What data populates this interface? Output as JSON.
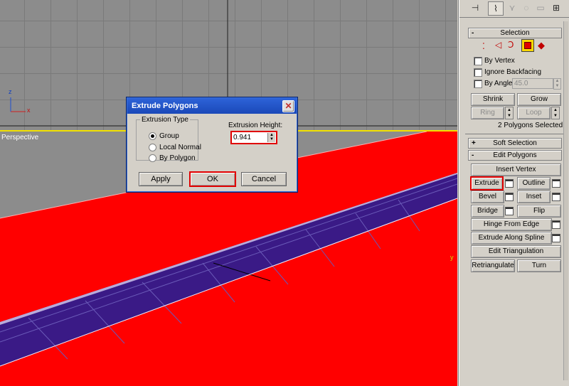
{
  "viewports": {
    "perspective_label": "Perspective",
    "axis_labels": {
      "x": "x",
      "z": "z",
      "y": "y"
    }
  },
  "dialog": {
    "title": "Extrude Polygons",
    "close_glyph": "✕",
    "extrusion_type": {
      "legend": "Extrusion Type",
      "options": [
        "Group",
        "Local Normal",
        "By Polygon"
      ],
      "selected": "Group"
    },
    "extrusion_height": {
      "label": "Extrusion Height:",
      "value": "0.941"
    },
    "buttons": {
      "apply": "Apply",
      "ok": "OK",
      "cancel": "Cancel"
    }
  },
  "panel": {
    "selection": {
      "title": "Selection",
      "by_vertex": "By Vertex",
      "ignore_backfacing": "Ignore Backfacing",
      "by_angle": "By Angle:",
      "angle_value": "45.0",
      "shrink": "Shrink",
      "grow": "Grow",
      "ring": "Ring",
      "loop": "Loop",
      "status": "2 Polygons Selected"
    },
    "soft_selection": {
      "title": "Soft Selection",
      "sign": "+"
    },
    "edit_polygons": {
      "title": "Edit Polygons",
      "sign": "-",
      "insert_vertex": "Insert Vertex",
      "extrude": "Extrude",
      "outline": "Outline",
      "bevel": "Bevel",
      "inset": "Inset",
      "bridge": "Bridge",
      "flip": "Flip",
      "hinge_from_edge": "Hinge From Edge",
      "extrude_along_spline": "Extrude Along Spline",
      "edit_triangulation": "Edit Triangulation",
      "retriangulate": "Retriangulate",
      "turn": "Turn"
    },
    "selection_sign": "-"
  },
  "colors": {
    "viewport_bg": "#8c8c8c",
    "surface_red": "#ff0000",
    "road_purple": "#3a1a86",
    "active_border": "#f2e100",
    "highlight_red": "#e00000",
    "dialog_title": "#2357d0"
  }
}
